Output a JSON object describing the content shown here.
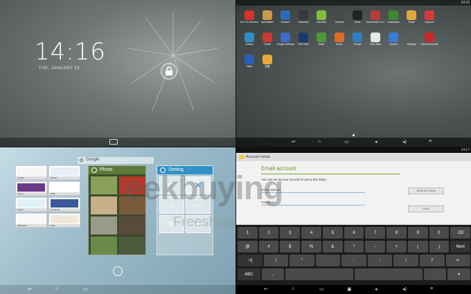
{
  "lock": {
    "time": "14:16",
    "date": "TUE, JANUARY 13"
  },
  "apps": {
    "status_time": "14:16",
    "items": [
      {
        "label": "AnTuTu Benchmark",
        "color": "#d8322a"
      },
      {
        "label": "ApkInstaller",
        "color": "#c99a4a"
      },
      {
        "label": "Browser",
        "color": "#2a6bb8"
      },
      {
        "label": "Calculator",
        "color": "#3a3a3a"
      },
      {
        "label": "Calendar",
        "color": "#7fbf3a"
      },
      {
        "label": "Camera",
        "color": "#4a4a4a"
      },
      {
        "label": "Clock",
        "color": "#222222"
      },
      {
        "label": "Documents To Go",
        "color": "#b83a3a"
      },
      {
        "label": "Downloads",
        "color": "#3d8a2e"
      },
      {
        "label": "Email",
        "color": "#e0a93a"
      },
      {
        "label": "Explorer",
        "color": "#d83a3a"
      },
      {
        "label": "",
        "color": "transparent"
      },
      {
        "label": "Gallery",
        "color": "#2f8ec8"
      },
      {
        "label": "Gmail",
        "color": "#c93a2f"
      },
      {
        "label": "Google Settings",
        "color": "#3a6cc8"
      },
      {
        "label": "GPS Test",
        "color": "#1a3a6a"
      },
      {
        "label": "Maps",
        "color": "#4a9a3a"
      },
      {
        "label": "Music",
        "color": "#e06a2a"
      },
      {
        "label": "People",
        "color": "#2f7fc8"
      },
      {
        "label": "Play Store",
        "color": "#e8e8e8"
      },
      {
        "label": "Search",
        "color": "#3a7ad8"
      },
      {
        "label": "Settings",
        "color": "#5a5a5a"
      },
      {
        "label": "Sound Recorder",
        "color": "#c82a2a"
      },
      {
        "label": "",
        "color": "transparent"
      },
      {
        "label": "Video",
        "color": "#2a5fb8"
      },
      {
        "label": "优酷",
        "color": "#e8a83a"
      }
    ]
  },
  "recent": {
    "search_label": "Google",
    "thumbs": [
      "Google",
      "Picasa",
      "Yahoo!",
      "MSN",
      "Twitter",
      "Facebook",
      "Wikipedia",
      "eBay"
    ],
    "photo_title": "Photo",
    "setting_title": "Setting"
  },
  "setup": {
    "status_time": "14:17",
    "bar_title": "Account setup",
    "heading": "Email account",
    "subtitle": "You can set up your account in just a few steps.",
    "email_placeholder": "Email address",
    "password_placeholder": "Password",
    "manual_label": "Manual setup",
    "next_label": "Next",
    "rows": [
      [
        "1",
        "2",
        "3",
        "4",
        "5",
        "6",
        "7",
        "8",
        "9",
        "0",
        "⌫"
      ],
      [
        "@",
        "#",
        "$",
        "%",
        "&",
        "*",
        "-",
        "+",
        "(",
        ")",
        "Next"
      ],
      [
        "~\\{",
        "!",
        "\"",
        "'",
        ":",
        ";",
        "/",
        "?",
        "↵"
      ],
      [
        "ABC",
        ",",
        "",
        "",
        ".",
        "▾"
      ]
    ]
  },
  "watermark": {
    "brand": "eekbuying",
    "tagline": "Freeshipp"
  }
}
